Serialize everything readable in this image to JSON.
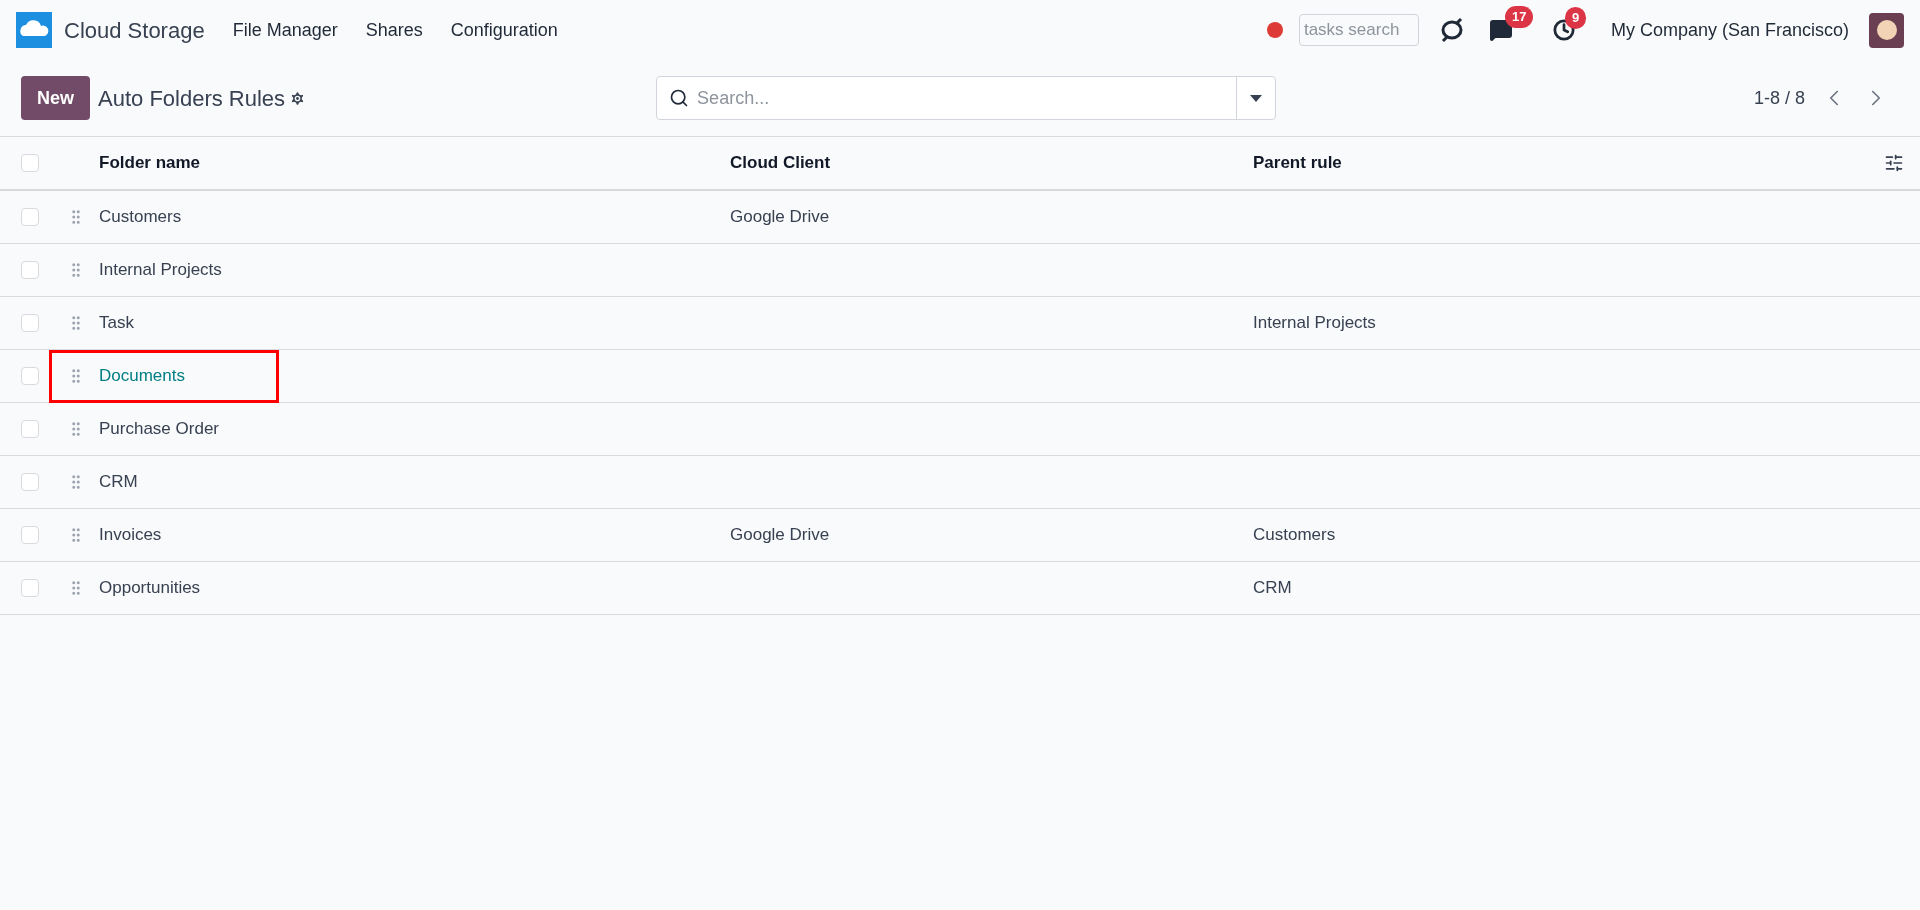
{
  "navbar": {
    "app_name": "Cloud Storage",
    "menu": [
      "File Manager",
      "Shares",
      "Configuration"
    ],
    "tasks_search": {
      "placeholder": "tasks search"
    },
    "messages_count": "17",
    "activities_count": "9",
    "company": "My Company (San Francisco)"
  },
  "control_panel": {
    "new_button": "New",
    "title": "Auto Folders Rules",
    "search": {
      "placeholder": "Search..."
    },
    "pager": "1-8 / 8"
  },
  "table": {
    "select_all_checked": false,
    "columns": [
      "Folder name",
      "Cloud Client",
      "Parent rule"
    ],
    "rows": [
      {
        "folder_name": "Customers",
        "cloud_client": "Google Drive",
        "parent_rule": "",
        "checked": false,
        "highlighted": false
      },
      {
        "folder_name": "Internal Projects",
        "cloud_client": "",
        "parent_rule": "",
        "checked": false,
        "highlighted": false
      },
      {
        "folder_name": "Task",
        "cloud_client": "",
        "parent_rule": "Internal Projects",
        "checked": false,
        "highlighted": false
      },
      {
        "folder_name": "Documents",
        "cloud_client": "",
        "parent_rule": "",
        "checked": false,
        "highlighted": true
      },
      {
        "folder_name": "Purchase Order",
        "cloud_client": "",
        "parent_rule": "",
        "checked": false,
        "highlighted": false
      },
      {
        "folder_name": "CRM",
        "cloud_client": "",
        "parent_rule": "",
        "checked": false,
        "highlighted": false
      },
      {
        "folder_name": "Invoices",
        "cloud_client": "Google Drive",
        "parent_rule": "Customers",
        "checked": false,
        "highlighted": false
      },
      {
        "folder_name": "Opportunities",
        "cloud_client": "",
        "parent_rule": "CRM",
        "checked": false,
        "highlighted": false
      }
    ]
  }
}
